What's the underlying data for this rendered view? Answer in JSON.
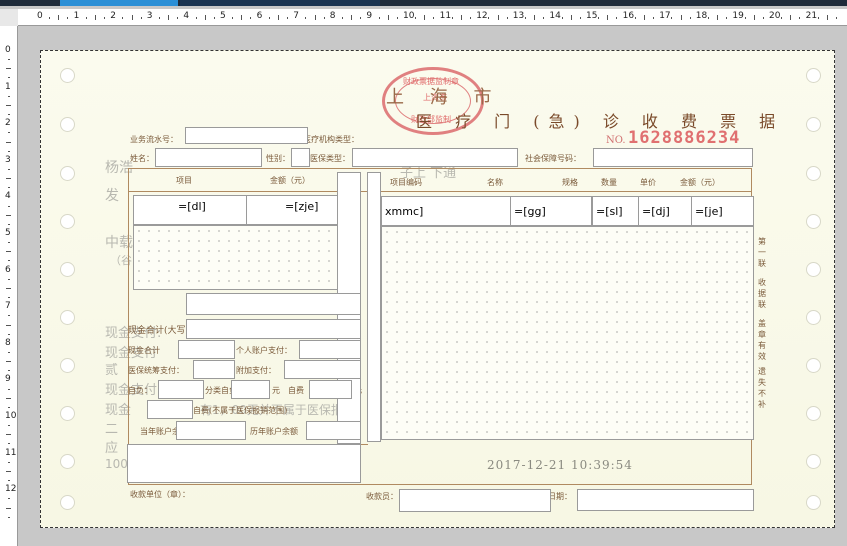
{
  "rulers": {
    "horizontal": [
      "0",
      "1",
      "2",
      "3",
      "4",
      "5",
      "6",
      "7",
      "8",
      "9",
      "10",
      "11",
      "12",
      "13",
      "14",
      "15",
      "16",
      "17",
      "18",
      "19",
      "20",
      "21"
    ],
    "vertical": [
      "0",
      "1",
      "2",
      "3",
      "4",
      "5",
      "6",
      "7",
      "8",
      "9",
      "10",
      "11",
      "12"
    ]
  },
  "receipt": {
    "region": "上 海 市",
    "title": "医 疗 门 (急) 诊 收 费 票 据",
    "no_label": "NO.",
    "no_value": "1628886234",
    "stamp_top": "财政票据监制章",
    "stamp_mid": "上海市",
    "stamp_bottom": "财政部监制",
    "datetime": "2017-12-21 10:39:54",
    "labels": {
      "serial": "业务流水号：",
      "org_type": "医疗机构类型：",
      "name": "姓名：",
      "gender": "性别：",
      "insurance_type": "医保类型：",
      "social_no": "社会保障号码：",
      "item": "项目",
      "amount": "金额（元）",
      "item_code": "项目编码",
      "item_name": "名称",
      "spec": "规格",
      "qty": "数量",
      "unit_price": "单价",
      "amount2": "金额（元）",
      "cash_cap": "现金合计(大写)：",
      "cash_total": "现金合计",
      "personal_pay": "个人账户支付：",
      "medical_pay": "医保统筹支付：",
      "extra_pay": "附加支付：",
      "self_pay": "自负：",
      "self_pay_b": "分类自负",
      "unit_yuan": "元",
      "self_pay_c": "自费",
      "self_pay_note": "自费(不属于医保报销范围)",
      "cur_balance": "当年账户余额",
      "prev_balance": "历年账户余额",
      "payee_unit": "收款单位（章）：",
      "payee": "收款员：",
      "date": "日期："
    },
    "side_text": [
      "第",
      "一",
      "联",
      "收",
      "据",
      "联",
      "盖",
      "章",
      "有",
      "效",
      "遗",
      "失",
      "不",
      "补"
    ],
    "template_fields": {
      "dl": "=[dl]",
      "zje": "=[zje]",
      "xmmc": "xmmc]",
      "gg": "=[gg]",
      "sl": "=[sl]",
      "dj": "=[dj]",
      "je": "=[je]"
    },
    "ghost_text": {
      "g1": "杨浩",
      "g2": "发",
      "g3": "中载",
      "g4": "（谷",
      "g5": "现金支付:",
      "g6": "现金支付",
      "g7": "贰",
      "g8": "现金支付",
      "g9": "现金",
      "g10": "二",
      "g11": "应",
      "g12": "100",
      "g13": "子上  下通",
      "g14": "有1，00无并不属于医保报销"
    }
  }
}
